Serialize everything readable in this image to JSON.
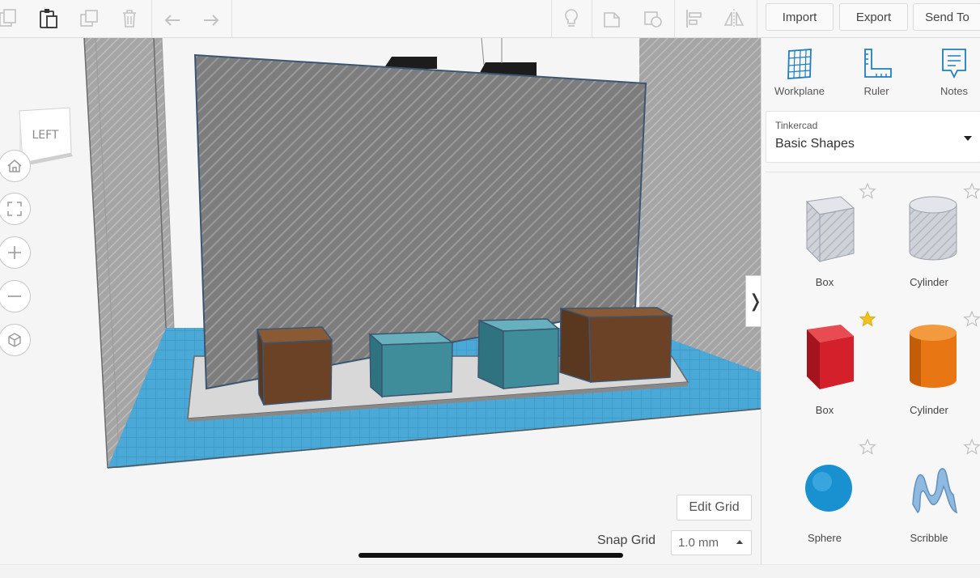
{
  "toolbar": {
    "import_label": "Import",
    "export_label": "Export",
    "send_to_label": "Send To"
  },
  "view_cube": {
    "face_label": "LEFT"
  },
  "viewport": {
    "edit_grid_label": "Edit Grid",
    "snap_grid_label": "Snap Grid",
    "snap_grid_value": "1.0 mm",
    "collapse_glyph": "❭"
  },
  "panel": {
    "tools": [
      {
        "label": "Workplane",
        "icon": "workplane-icon"
      },
      {
        "label": "Ruler",
        "icon": "ruler-icon"
      },
      {
        "label": "Notes",
        "icon": "notes-icon"
      }
    ],
    "library": {
      "category": "Tinkercad",
      "name": "Basic Shapes"
    },
    "shapes": [
      {
        "label": "Box",
        "style": "hole",
        "favorite": false
      },
      {
        "label": "Cylinder",
        "style": "hole",
        "favorite": false
      },
      {
        "label": "Box",
        "style": "solid",
        "color": "#d4202a",
        "favorite": true
      },
      {
        "label": "Cylinder",
        "style": "solid",
        "color": "#e87612",
        "favorite": false
      },
      {
        "label": "Sphere",
        "style": "solid",
        "color": "#1991d1",
        "favorite": false
      },
      {
        "label": "Scribble",
        "style": "solid",
        "color": "#8fb9de",
        "favorite": false
      }
    ]
  },
  "colors": {
    "accent_blue": "#1f7fbf",
    "workplane_blue": "#4aa9d6",
    "brown_box": "#6b4226",
    "teal_box": "#3f8c9a",
    "favorite_star": "#f3c21a"
  }
}
